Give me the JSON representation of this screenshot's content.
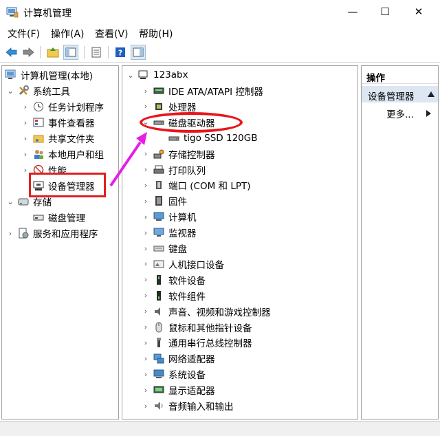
{
  "window": {
    "title": "计算机管理",
    "minimize_glyph": "—",
    "maximize_glyph": "☐",
    "close_glyph": "✕"
  },
  "menubar": {
    "file": "文件(F)",
    "action": "操作(A)",
    "view": "查看(V)",
    "help": "帮助(H)"
  },
  "toolbar": {
    "buttons": [
      "back-icon",
      "forward-icon",
      "up-folder-icon",
      "show-hide-tree-icon",
      "properties-icon",
      "help-icon",
      "show-action-pane-icon"
    ]
  },
  "left_tree": {
    "root": "计算机管理(本地)",
    "system_tools": "系统工具",
    "task_scheduler": "任务计划程序",
    "event_viewer": "事件查看器",
    "shared_folders": "共享文件夹",
    "local_users": "本地用户和组",
    "performance": "性能",
    "device_manager": "设备管理器",
    "storage": "存储",
    "disk_management": "磁盘管理",
    "services": "服务和应用程序"
  },
  "device_tree": {
    "computer": "123abx",
    "categories": [
      {
        "label": "IDE ATA/ATAPI 控制器",
        "icon": "ide-controller-icon",
        "expanded": false
      },
      {
        "label": "处理器",
        "icon": "processor-icon",
        "expanded": false
      },
      {
        "label": "磁盘驱动器",
        "icon": "disk-drive-icon",
        "expanded": true
      },
      {
        "label": "tigo SSD 120GB",
        "icon": "disk-drive-icon",
        "child": true
      },
      {
        "label": "存储控制器",
        "icon": "storage-controller-icon",
        "expanded": false
      },
      {
        "label": "打印队列",
        "icon": "printer-icon",
        "expanded": false
      },
      {
        "label": "端口 (COM 和 LPT)",
        "icon": "port-icon",
        "expanded": false
      },
      {
        "label": "固件",
        "icon": "firmware-icon",
        "expanded": false
      },
      {
        "label": "计算机",
        "icon": "computer-icon",
        "expanded": false
      },
      {
        "label": "监视器",
        "icon": "monitor-icon",
        "expanded": false
      },
      {
        "label": "键盘",
        "icon": "keyboard-icon",
        "expanded": false
      },
      {
        "label": "人机接口设备",
        "icon": "hid-icon",
        "expanded": false
      },
      {
        "label": "软件设备",
        "icon": "software-device-icon",
        "expanded": false
      },
      {
        "label": "软件组件",
        "icon": "software-component-icon",
        "expanded": false
      },
      {
        "label": "声音、视频和游戏控制器",
        "icon": "sound-icon",
        "expanded": false
      },
      {
        "label": "鼠标和其他指针设备",
        "icon": "mouse-icon",
        "expanded": false
      },
      {
        "label": "通用串行总线控制器",
        "icon": "usb-icon",
        "expanded": false
      },
      {
        "label": "网络适配器",
        "icon": "network-adapter-icon",
        "expanded": false
      },
      {
        "label": "系统设备",
        "icon": "system-device-icon",
        "expanded": false
      },
      {
        "label": "显示适配器",
        "icon": "display-adapter-icon",
        "expanded": false
      },
      {
        "label": "音频输入和输出",
        "icon": "audio-io-icon",
        "expanded": false
      }
    ]
  },
  "actions_pane": {
    "header": "操作",
    "section": "设备管理器",
    "more": "更多..."
  },
  "colors": {
    "annotation_red": "#e8161a",
    "annotation_arrow": "#e61ee6",
    "selected_section_bg": "#dde7f3"
  }
}
